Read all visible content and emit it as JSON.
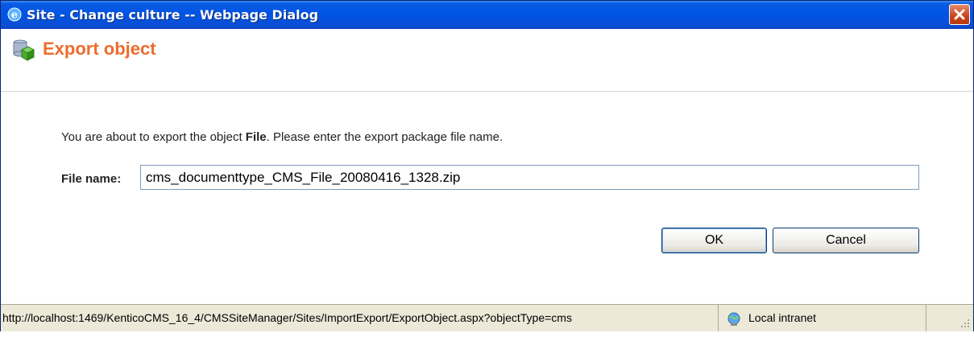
{
  "window": {
    "title": "Site - Change culture -- Webpage Dialog"
  },
  "header": {
    "title": "Export object"
  },
  "content": {
    "intro_prefix": "You are about to export the object ",
    "intro_object": "File",
    "intro_suffix": ". Please enter the export package file name.",
    "file_name_label": "File name:",
    "file_name_value": "cms_documenttype_CMS_File_20080416_1328.zip"
  },
  "buttons": {
    "ok": "OK",
    "cancel": "Cancel"
  },
  "statusbar": {
    "url": "http://localhost:1469/KenticoCMS_16_4/CMSSiteManager/Sites/ImportExport/ExportObject.aspx?objectType=cms",
    "zone": "Local intranet"
  },
  "icons": {
    "title": "ie-icon",
    "header": "export-object-icon",
    "close": "close-icon",
    "zone": "local-intranet-icon",
    "grip": "resize-grip-icon"
  },
  "colors": {
    "title_bar": "#0054e3",
    "header_title": "#ee6c2c",
    "close_button": "#c9441c"
  }
}
